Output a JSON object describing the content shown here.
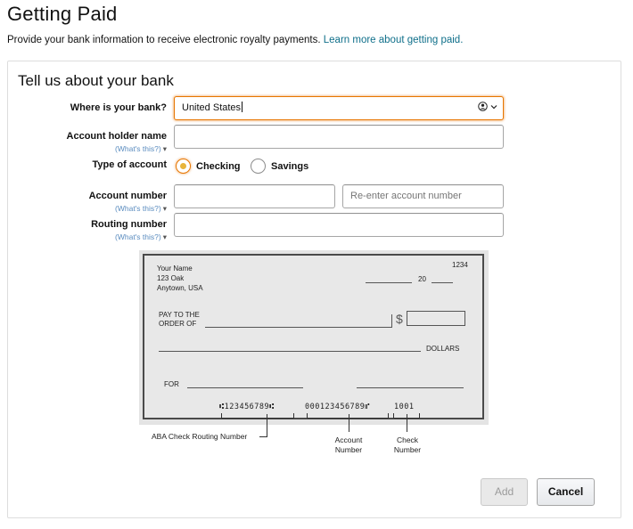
{
  "header": {
    "title": "Getting Paid",
    "intro": "Provide your bank information to receive electronic royalty payments.",
    "learn_more": "Learn more about getting paid."
  },
  "form": {
    "title": "Tell us about your bank",
    "bank_location": {
      "label": "Where is your bank?",
      "value": "United States"
    },
    "account_holder": {
      "label": "Account holder name",
      "help": "(What's this?)",
      "value": ""
    },
    "account_type": {
      "label": "Type of account",
      "options": [
        "Checking",
        "Savings"
      ],
      "selected": "Checking"
    },
    "account_number": {
      "label": "Account number",
      "help": "(What's this?)",
      "value": "",
      "reenter_placeholder": "Re-enter account number"
    },
    "routing_number": {
      "label": "Routing number",
      "help": "(What's this?)",
      "value": ""
    }
  },
  "check_image": {
    "name": "Your Name",
    "address1": "123 Oak",
    "address2": "Anytown, USA",
    "check_no": "1234",
    "date_prefix": "20",
    "pay_to_1": "PAY TO THE",
    "pay_to_2": "ORDER OF",
    "dollar_sign": "$",
    "dollars": "DOLLARS",
    "memo": "FOR",
    "micr_routing": "⑆123456789⑆",
    "micr_account": "000123456789⑈",
    "micr_check": "1001",
    "caption_routing": "ABA Check Routing Number",
    "caption_account_1": "Account",
    "caption_account_2": "Number",
    "caption_check_1": "Check",
    "caption_check_2": "Number"
  },
  "buttons": {
    "add": "Add",
    "cancel": "Cancel"
  },
  "colors": {
    "link": "#0f6f8a",
    "focus": "#e77600",
    "help": "#5a8cbf"
  }
}
